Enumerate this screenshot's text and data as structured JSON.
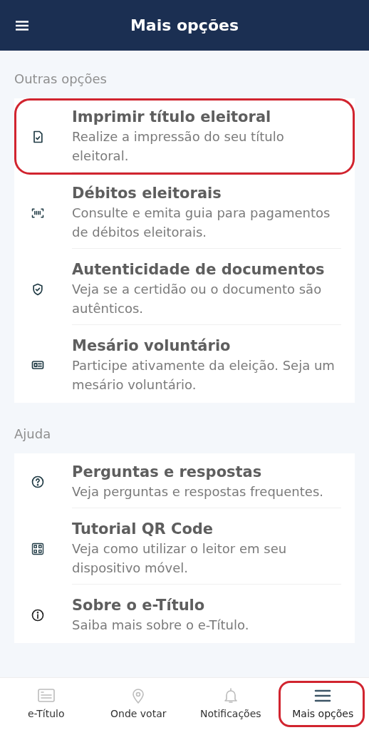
{
  "header": {
    "title": "Mais opções"
  },
  "sections": [
    {
      "label": "Outras opções",
      "items": [
        {
          "kind": "print",
          "title": "Imprimir título eleitoral",
          "description": "Realize a impressão do seu título eleitoral.",
          "highlighted": true
        },
        {
          "kind": "debts",
          "title": "Débitos eleitorais",
          "description": "Consulte e emita guia para pagamentos de débitos eleitorais.",
          "highlighted": false
        },
        {
          "kind": "authenticity",
          "title": "Autenticidade de documentos",
          "description": "Veja se a certidão ou o documento são autênticos.",
          "highlighted": false
        },
        {
          "kind": "volunteer",
          "title": "Mesário voluntário",
          "description": "Participe ativamente da eleição. Seja um mesário voluntário.",
          "highlighted": false
        }
      ]
    },
    {
      "label": "Ajuda",
      "items": [
        {
          "kind": "faq",
          "title": "Perguntas e respostas",
          "description": "Veja perguntas e respostas frequentes.",
          "highlighted": false
        },
        {
          "kind": "tutorial",
          "title": "Tutorial QR Code",
          "description": "Veja como utilizar o leitor em seu dispositivo móvel.",
          "highlighted": false
        },
        {
          "kind": "about",
          "title": "Sobre o e-Título",
          "description": "Saiba mais sobre o e-Título.",
          "highlighted": false
        }
      ]
    }
  ],
  "nav": [
    {
      "kind": "title",
      "label": "e-Título",
      "selected": false,
      "highlighted": false
    },
    {
      "kind": "location",
      "label": "Onde votar",
      "selected": false,
      "highlighted": false
    },
    {
      "kind": "notifications",
      "label": "Notificações",
      "selected": false,
      "highlighted": false
    },
    {
      "kind": "more",
      "label": "Mais opções",
      "selected": true,
      "highlighted": true
    }
  ]
}
